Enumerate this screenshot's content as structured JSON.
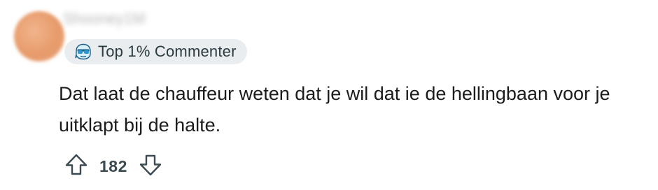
{
  "comment": {
    "author": "Shooney1M",
    "badge": {
      "label": "Top 1% Commenter",
      "icon": "sunglasses-badge-icon"
    },
    "text": "Dat laat de chauffeur weten dat je wil dat ie de hellingbaan voor je uitklapt bij de halte.",
    "score": "182",
    "icons": {
      "upvote": "arrow-up-icon",
      "downvote": "arrow-down-icon"
    },
    "colors": {
      "badge_bg": "#eaedef",
      "badge_icon": "#3aa6d8",
      "text": "#1c1c1c",
      "icon_stroke": "#3c4a52"
    }
  }
}
